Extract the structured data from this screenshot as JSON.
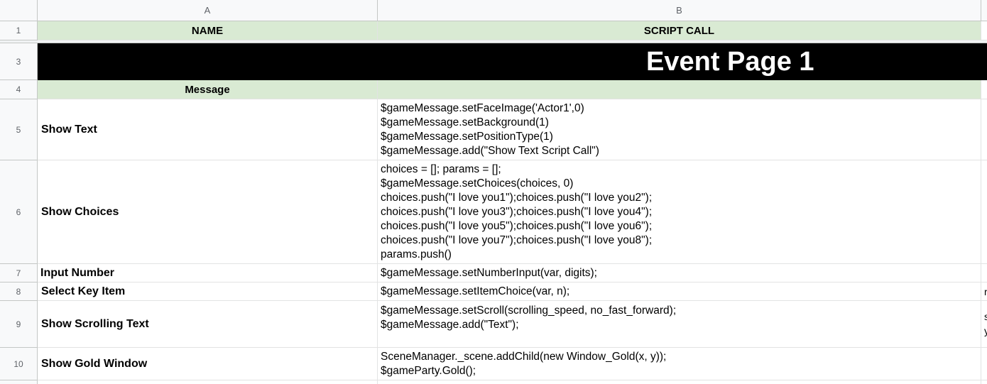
{
  "columns": {
    "a": "A",
    "b": "B"
  },
  "rows": {
    "r1": {
      "num": "1",
      "a": "NAME",
      "b": "SCRIPT CALL"
    },
    "r3": {
      "num": "3",
      "banner": "Event Page 1"
    },
    "r4": {
      "num": "4",
      "a": "Message",
      "b": ""
    },
    "r5": {
      "num": "5",
      "a": "Show Text",
      "b": [
        "$gameMessage.setFaceImage('Actor1',0)",
        "$gameMessage.setBackground(1)",
        "$gameMessage.setPositionType(1)",
        "$gameMessage.add(\"Show Text Script Call\")"
      ]
    },
    "r6": {
      "num": "6",
      "a": "Show Choices",
      "b": [
        "choices = []; params = [];",
        "$gameMessage.setChoices(choices, 0)",
        "choices.push(\"I love you1\");choices.push(\"I love you2\");",
        "choices.push(\"I love you3\");choices.push(\"I love you4\");",
        "choices.push(\"I love you5\");choices.push(\"I love you6\");",
        "choices.push(\"I love you7\");choices.push(\"I love you8\");",
        "params.push()"
      ]
    },
    "r7": {
      "num": "7",
      "a": "Input Number",
      "b": [
        "$gameMessage.setNumberInput(var, digits);"
      ]
    },
    "r8": {
      "num": "8",
      "a": "Select Key Item",
      "b": [
        "$gameMessage.setItemChoice(var, n);"
      ],
      "c": [
        "r"
      ]
    },
    "r9": {
      "num": "9",
      "a": "Show Scrolling Text",
      "b": [
        "$gameMessage.setScroll(scrolling_speed, no_fast_forward);",
        "$gameMessage.add(\"Text\");"
      ],
      "c": [
        "s",
        "y"
      ]
    },
    "r10": {
      "num": "10",
      "a": "Show Gold Window",
      "b": [
        "SceneManager._scene.addChild(new Window_Gold(x, y));",
        "$gameParty.Gold();"
      ]
    }
  }
}
